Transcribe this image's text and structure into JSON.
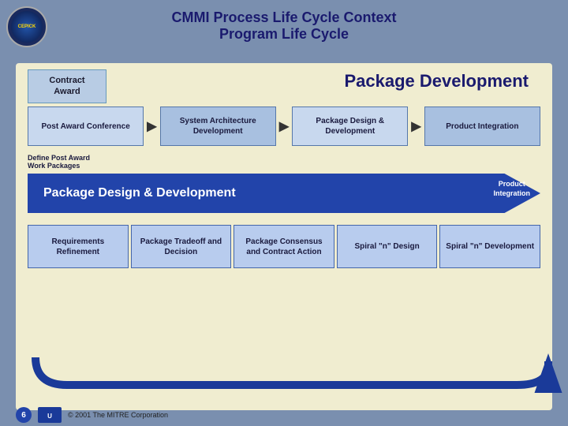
{
  "header": {
    "title_line1": "CMMI Process Life Cycle Context",
    "title_line2": "Program Life Cycle"
  },
  "logo": {
    "text": "CEPICK"
  },
  "content": {
    "package_development_label": "Package Development",
    "contract_award": "Contract Award",
    "process_boxes": [
      {
        "label": "Post Award Conference"
      },
      {
        "label": "System Architecture Development"
      },
      {
        "label": "Package Design & Development"
      },
      {
        "label": "Product Integration"
      }
    ],
    "define_text_line1": "Define Post Award",
    "define_text_line2": "Work Packages",
    "blue_arrow_label": "Package Design & Development",
    "product_integration_label": "Product\nIntegration",
    "bottom_boxes": [
      {
        "label": "Requirements Refinement"
      },
      {
        "label": "Package Tradeoff and Decision"
      },
      {
        "label": "Package Consensus and Contract Action"
      },
      {
        "label": "Spiral \"n\" Design"
      },
      {
        "label": "Spiral \"n\" Development"
      }
    ]
  },
  "footer": {
    "page_number": "6",
    "copyright": "© 2001 The MITRE Corporation"
  },
  "colors": {
    "header_text": "#1a1a6e",
    "body_bg": "#7a8faf",
    "content_bg": "#f0edd0",
    "box_bg": "#b8cce4",
    "arrow_blue": "#2244aa",
    "label_color": "#1a1a3e"
  }
}
